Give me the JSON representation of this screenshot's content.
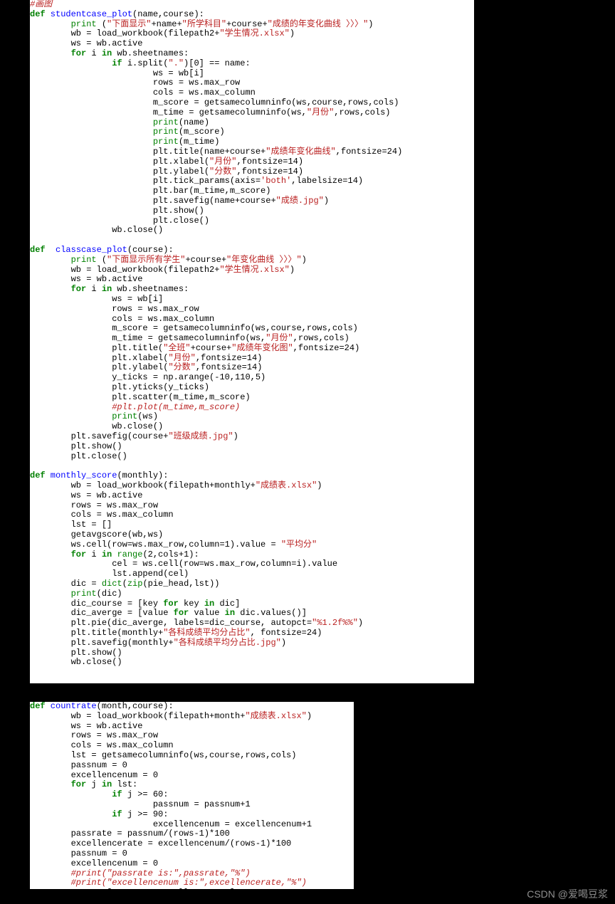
{
  "watermark": "CSDN @爱喝豆浆",
  "t": {
    "l00": "#画图",
    "l01a": "def",
    "l01b": " studentcase_plot",
    "l01c": "(name,course):",
    "l02a": "        ",
    "l02b": "print",
    "l02c": " (",
    "l02d": "\"下面显示\"",
    "l02e": "+name+",
    "l02f": "\"所学科目\"",
    "l02g": "+course+",
    "l02h": "\"成绩的年变化曲线 〉〉〉\"",
    "l02i": ")",
    "l03a": "        wb = load_workbook(filepath2+",
    "l03b": "\"学生情况.xlsx\"",
    "l03c": ")",
    "l04": "        ws = wb.active",
    "l05a": "        ",
    "l05b": "for",
    "l05c": " i ",
    "l05d": "in",
    "l05e": " wb.sheetnames:",
    "l06a": "                ",
    "l06b": "if",
    "l06c": " i.split(",
    "l06d": "\".\"",
    "l06e": ")[0] == name:",
    "l07": "                        ws = wb[i]",
    "l08": "                        rows = ws.max_row",
    "l09": "                        cols = ws.max_column",
    "l10": "                        m_score = getsamecolumninfo(ws,course,rows,cols)",
    "l11a": "                        m_time = getsamecolumninfo(ws,",
    "l11b": "\"月份\"",
    "l11c": ",rows,cols)",
    "l12a": "                        ",
    "l12b": "print",
    "l12c": "(name)",
    "l13a": "                        ",
    "l13b": "print",
    "l13c": "(m_score)",
    "l14a": "                        ",
    "l14b": "print",
    "l14c": "(m_time)",
    "l15a": "                        plt.title(name+course+",
    "l15b": "\"成绩年变化曲线\"",
    "l15c": ",fontsize=24)",
    "l16a": "                        plt.xlabel(",
    "l16b": "\"月份\"",
    "l16c": ",fontsize=14)",
    "l17a": "                        plt.ylabel(",
    "l17b": "\"分数\"",
    "l17c": ",fontsize=14)",
    "l18a": "                        plt.tick_params(axis=",
    "l18b": "'both'",
    "l18c": ",labelsize=14)",
    "l19": "                        plt.bar(m_time,m_score)",
    "l20a": "                        plt.savefig(name+course+",
    "l20b": "\"成绩.jpg\"",
    "l20c": ")",
    "l21": "                        plt.show()",
    "l22": "                        plt.close()",
    "l23": "                wb.close()",
    "l24": "",
    "l25a": "def",
    "l25b": "  classcase_plot",
    "l25c": "(course):",
    "l26a": "        ",
    "l26b": "print",
    "l26c": " (",
    "l26d": "\"下面显示所有学生\"",
    "l26e": "+course+",
    "l26f": "\"年变化曲线 〉〉〉\"",
    "l26g": ")",
    "l27a": "        wb = load_workbook(filepath2+",
    "l27b": "\"学生情况.xlsx\"",
    "l27c": ")",
    "l28": "        ws = wb.active",
    "l29a": "        ",
    "l29b": "for",
    "l29c": " i ",
    "l29d": "in",
    "l29e": " wb.sheetnames:",
    "l30": "                ws = wb[i]",
    "l31": "                rows = ws.max_row",
    "l32": "                cols = ws.max_column",
    "l33": "                m_score = getsamecolumninfo(ws,course,rows,cols)",
    "l34a": "                m_time = getsamecolumninfo(ws,",
    "l34b": "\"月份\"",
    "l34c": ",rows,cols)",
    "l35a": "                plt.title(",
    "l35b": "\"全班\"",
    "l35c": "+course+",
    "l35d": "\"成绩年变化图\"",
    "l35e": ",fontsize=24)",
    "l36a": "                plt.xlabel(",
    "l36b": "\"月份\"",
    "l36c": ",fontsize=14)",
    "l37a": "                plt.ylabel(",
    "l37b": "\"分数\"",
    "l37c": ",fontsize=14)",
    "l38": "                y_ticks = np.arange(-10,110,5)",
    "l39": "                plt.yticks(y_ticks)",
    "l40": "                plt.scatter(m_time,m_score)",
    "l41": "                #plt.plot(m_time,m_score)",
    "l42a": "                ",
    "l42b": "print",
    "l42c": "(ws)",
    "l43": "                wb.close()",
    "l44a": "        plt.savefig(course+",
    "l44b": "\"班级成绩.jpg\"",
    "l44c": ")",
    "l45": "        plt.show()",
    "l46": "        plt.close()",
    "l47": "",
    "l48a": "def",
    "l48b": " monthly_score",
    "l48c": "(monthly):",
    "l49a": "        wb = load_workbook(filepath+monthly+",
    "l49b": "\"成绩表.xlsx\"",
    "l49c": ")",
    "l50": "        ws = wb.active",
    "l51": "        rows = ws.max_row",
    "l52": "        cols = ws.max_column",
    "l53": "        lst = []",
    "l54": "        getavgscore(wb,ws)",
    "l55a": "        ws.cell(row=ws.max_row,column=1).value = ",
    "l55b": "\"平均分\"",
    "l56a": "        ",
    "l56b": "for",
    "l56c": " i ",
    "l56d": "in",
    "l56e": " ",
    "l56f": "range",
    "l56g": "(2,cols+1):",
    "l57": "                cel = ws.cell(row=ws.max_row,column=i).value",
    "l58": "                lst.append(cel)",
    "l59a": "        dic = ",
    "l59b": "dict",
    "l59c": "(",
    "l59d": "zip",
    "l59e": "(pie_head,lst))",
    "l60a": "        ",
    "l60b": "print",
    "l60c": "(dic)",
    "l61a": "        dic_course = [key ",
    "l61b": "for",
    "l61c": " key ",
    "l61d": "in",
    "l61e": " dic]",
    "l62a": "        dic_averge = [value ",
    "l62b": "for",
    "l62c": " value ",
    "l62d": "in",
    "l62e": " dic.values()]",
    "l63a": "        plt.pie(dic_averge, labels=dic_course, autopct=",
    "l63b": "\"%1.2f%%\"",
    "l63c": ")",
    "l64a": "        plt.title(monthly+",
    "l64b": "\"各科成绩平均分占比\"",
    "l64c": ", fontsize=24)",
    "l65a": "        plt.savefig(monthly+",
    "l65b": "\"各科成绩平均分占比.jpg\"",
    "l65c": ")",
    "l66": "        plt.show()",
    "l67": "        wb.close()",
    "b00a": "def",
    "b00b": " countrate",
    "b00c": "(month,course):",
    "b01a": "        wb = load_workbook(filepath+month+",
    "b01b": "\"成绩表.xlsx\"",
    "b01c": ")",
    "b02": "        ws = wb.active",
    "b03": "        rows = ws.max_row",
    "b04": "        cols = ws.max_column",
    "b05": "        lst = getsamecolumninfo(ws,course,rows,cols)",
    "b06": "        passnum = 0",
    "b07": "        excellencenum = 0",
    "b08a": "        ",
    "b08b": "for",
    "b08c": " j ",
    "b08d": "in",
    "b08e": " lst:",
    "b09a": "                ",
    "b09b": "if",
    "b09c": " j >= 60:",
    "b10": "                        passnum = passnum+1",
    "b11a": "                ",
    "b11b": "if",
    "b11c": " j >= 90:",
    "b12": "                        excellencenum = excellencenum+1",
    "b13": "        passrate = passnum/(rows-1)*100",
    "b14": "        excellencerate = excellencenum/(rows-1)*100",
    "b15": "        passnum = 0",
    "b16": "        excellencenum = 0",
    "b17": "        #print(\"passrate is:\",passrate,\"%\")",
    "b18": "        #print(\"excellencenum is:\",excellencerate,\"%\")",
    "b19a": "        ",
    "b19b": "return",
    "b19c": " [passrate,excellencerate]"
  }
}
